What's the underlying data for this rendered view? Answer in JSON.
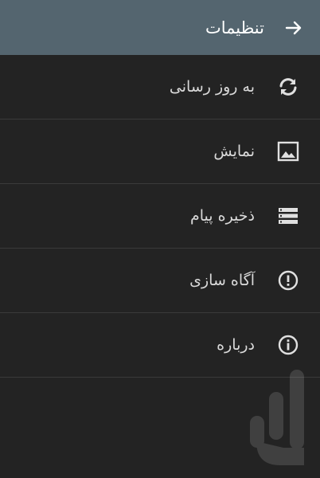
{
  "header": {
    "title": "تنظیمات",
    "back_icon": "arrow-right-icon"
  },
  "menu": {
    "items": [
      {
        "label": "به روز رسانی",
        "icon": "refresh-icon"
      },
      {
        "label": "نمایش",
        "icon": "image-icon"
      },
      {
        "label": "ذخیره پیام",
        "icon": "storage-icon"
      },
      {
        "label": "آگاه سازی",
        "icon": "alert-icon"
      },
      {
        "label": "درباره",
        "icon": "info-icon"
      }
    ]
  },
  "colors": {
    "appbar": "#54656f",
    "background": "#232323",
    "divider": "#3a3a3a"
  }
}
